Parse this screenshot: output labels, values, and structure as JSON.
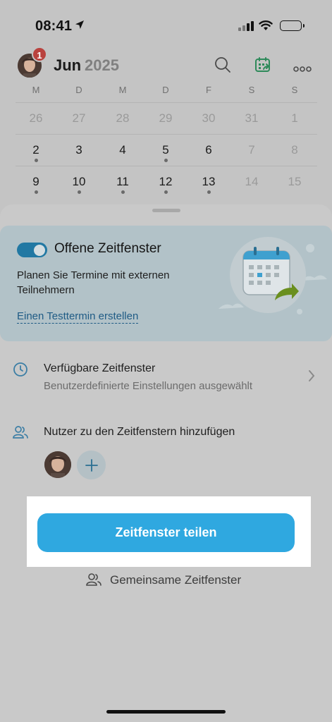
{
  "status_bar": {
    "time": "08:41"
  },
  "calendar_header": {
    "month": "Jun",
    "year": "2025",
    "notification_count": "1",
    "icons": [
      "search-icon",
      "calendar-share-icon",
      "more-icon"
    ],
    "accent_color": "#2e9c62"
  },
  "weekdays": [
    "M",
    "D",
    "M",
    "D",
    "F",
    "S",
    "S"
  ],
  "weeks": [
    [
      "26",
      "27",
      "28",
      "29",
      "30",
      "31",
      "1"
    ],
    [
      "2",
      "3",
      "4",
      "5",
      "6",
      "7",
      "8"
    ],
    [
      "9",
      "10",
      "11",
      "12",
      "13",
      "14",
      "15"
    ]
  ],
  "promo": {
    "title": "Offene Zeitfenster",
    "description": "Planen Sie Termine mit externen Teilnehmern",
    "link": "Einen Testtermin erstellen",
    "toggle_on": true
  },
  "available_slots": {
    "title": "Verfügbare Zeitfenster",
    "subtitle": "Benutzerdefinierte Einstellungen ausgewählt"
  },
  "add_users": {
    "title": "Nutzer zu den Zeitfenstern hinzufügen"
  },
  "share_button": {
    "label": "Zeitfenster teilen",
    "color": "#2fa8e0"
  },
  "shared_slots": {
    "label": "Gemeinsame Zeitfenster"
  }
}
